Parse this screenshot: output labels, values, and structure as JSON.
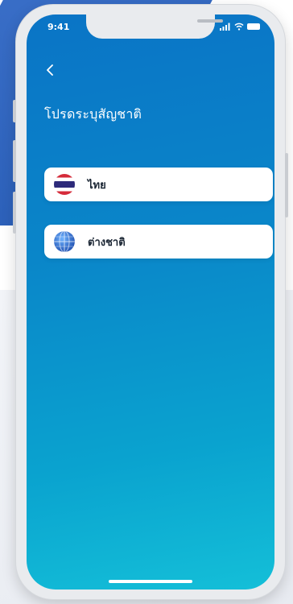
{
  "status_bar": {
    "time": "9:41"
  },
  "header": {
    "back_icon": "chevron-left-icon",
    "title": "โปรดระบุสัญชาติ"
  },
  "options": [
    {
      "label": "ไทย",
      "icon": "thailand-flag-icon"
    },
    {
      "label": "ต่างชาติ",
      "icon": "globe-icon"
    }
  ],
  "colors": {
    "screen_gradient_start": "#0a74c6",
    "screen_gradient_end": "#14bfd8",
    "card_background": "#ffffff",
    "label_text": "#1a2533",
    "thai_red": "#d52b3a",
    "thai_blue": "#2d2a7a",
    "globe_blue": "#1f6fd6"
  }
}
